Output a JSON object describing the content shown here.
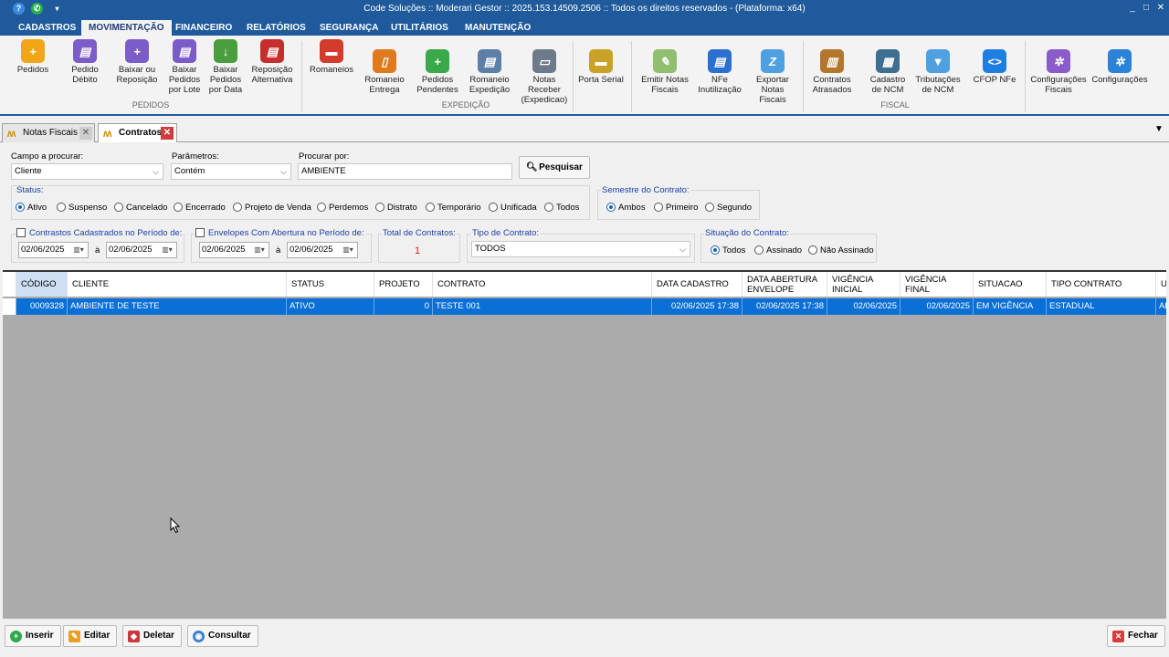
{
  "window": {
    "title": "Code Soluções :: Moderari Gestor :: 2025.153.14509.2506 :: Todos os direitos reservados - (Plataforma: x64)"
  },
  "menu": [
    "CADASTROS",
    "MOVIMENTAÇÃO",
    "FINANCEIRO",
    "RELATÓRIOS",
    "SEGURANÇA",
    "UTILITÁRIOS",
    "MANUTENÇÃO"
  ],
  "ribbon": {
    "buttons": [
      "Pedidos",
      "Pedido\nDébito",
      "Baixar ou\nReposição",
      "Baixar\nPedidos\npor Lote",
      "Baixar\nPedidos\npor Data",
      "Reposição\nAlternativa",
      "Romaneios",
      "Romaneio\nEntrega",
      "Pedidos\nPendentes",
      "Romaneio\nExpedição",
      "Notas\nReceber\n(Expedicao)",
      "Porta Serial",
      "Emitir Notas\nFiscais",
      "NFe\nInutilização",
      "Exportar\nNotas\nFiscais",
      "Contratos\nAtrasados",
      "Cadastro\nde NCM",
      "Tributações\nde NCM",
      "CFOP NFe",
      "Configurações\nFiscais",
      "Configurações"
    ],
    "groups": [
      "PEDIDOS",
      "EXPEDIÇÃO",
      "FISCAL"
    ]
  },
  "tabs": [
    "Notas Fiscais",
    "Contratos"
  ],
  "search": {
    "campo_label": "Campo a procurar:",
    "campo_value": "Cliente",
    "param_label": "Parâmetros:",
    "param_value": "Contém",
    "procurar_label": "Procurar por:",
    "procurar_value": "AMBIENTE",
    "pesquisar": "Pesquisar"
  },
  "status": {
    "label": "Status:",
    "options": [
      "Ativo",
      "Suspenso",
      "Cancelado",
      "Encerrado",
      "Projeto de Venda",
      "Perdemos",
      "Distrato",
      "Temporário",
      "Unificada",
      "Todos"
    ],
    "selected": "Ativo"
  },
  "semestre": {
    "label": "Semestre do Contrato:",
    "options": [
      "Ambos",
      "Primeiro",
      "Segundo"
    ],
    "selected": "Ambos"
  },
  "periodo1": {
    "label": "Contrastos Cadastrados no Período de:",
    "from": "02/06/2025",
    "sep": "à",
    "to": "02/06/2025"
  },
  "periodo2": {
    "label": "Envelopes Com Abertura no Período de:",
    "from": "02/06/2025",
    "sep": "à",
    "to": "02/06/2025"
  },
  "total": {
    "label": "Total de Contratos:",
    "value": "1"
  },
  "tipo": {
    "label": "Tipo de Contrato:",
    "value": "TODOS"
  },
  "situacao": {
    "label": "Situação do Contrato:",
    "options": [
      "Todos",
      "Assinado",
      "Não Assinado"
    ],
    "selected": "Todos"
  },
  "grid": {
    "columns": [
      "CÓDIGO",
      "CLIENTE",
      "STATUS",
      "PROJETO",
      "CONTRATO",
      "DATA CADASTRO",
      "DATA ABERTURA\nENVELOPE",
      "VIGÊNCIA\nINICIAL",
      "VIGÊNCIA\nFINAL",
      "SITUACAO",
      "TIPO CONTRATO",
      "US"
    ],
    "rows": [
      [
        "0009328",
        "AMBIENTE DE TESTE",
        "ATIVO",
        "0",
        "TESTE 001",
        "02/06/2025 17:38",
        "02/06/2025 17:38",
        "02/06/2025",
        "02/06/2025",
        "EM VIGÊNCIA",
        "ESTADUAL",
        "AD"
      ]
    ]
  },
  "footer": {
    "inserir": "Inserir",
    "editar": "Editar",
    "deletar": "Deletar",
    "consultar": "Consultar",
    "fechar": "Fechar"
  }
}
